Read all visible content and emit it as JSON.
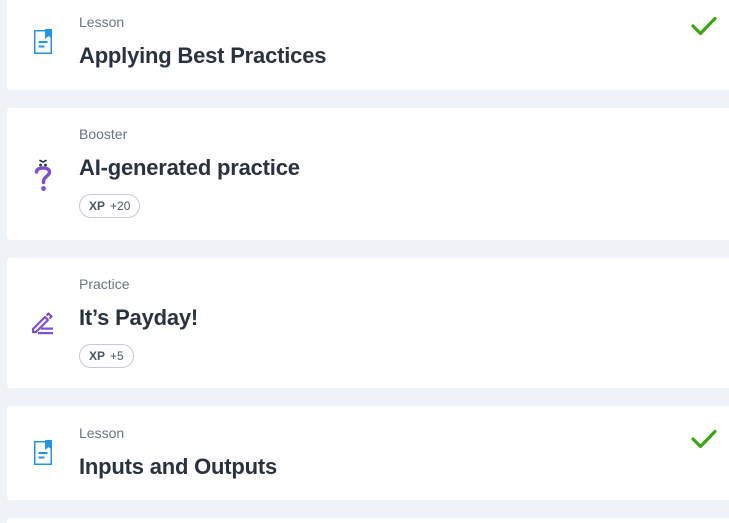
{
  "items": [
    {
      "type": "Lesson",
      "title": "Applying Best Practices",
      "icon": "lesson-document-icon",
      "completed": true
    },
    {
      "type": "Booster",
      "title": "AI-generated practice",
      "icon": "booster-question-icon",
      "xp_label": "XP",
      "xp_value": "+20",
      "completed": false
    },
    {
      "type": "Practice",
      "title": "It’s Payday!",
      "icon": "practice-pencil-icon",
      "xp_label": "XP",
      "xp_value": "+5",
      "completed": false
    },
    {
      "type": "Lesson",
      "title": "Inputs and Outputs",
      "icon": "lesson-document-icon",
      "completed": true
    }
  ],
  "colors": {
    "lesson_icon": "#2196e8",
    "booster_icon": "#7d4fd6",
    "practice_icon": "#7d4fd6",
    "check": "#3aa60c",
    "background": "#eff2f6",
    "title_text": "#2a3240",
    "label_text": "#6a7585"
  }
}
